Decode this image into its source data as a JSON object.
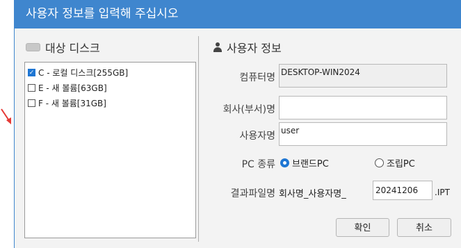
{
  "window": {
    "title": "사용자 정보를 입력해 주십시오"
  },
  "disks": {
    "title": "대상 디스크",
    "items": [
      {
        "label": "C - 로컬 디스크[255GB]",
        "checked": true
      },
      {
        "label": "E - 새 볼륨[63GB]",
        "checked": false
      },
      {
        "label": "F - 새 볼륨[31GB]",
        "checked": false
      }
    ]
  },
  "user": {
    "title": "사용자 정보",
    "computer_label": "컴퓨터명",
    "computer_value": "DESKTOP-WIN2024",
    "company_label": "회사(부서)명",
    "company_value": "",
    "username_label": "사용자명",
    "username_value": "user",
    "pc_type_label": "PC 종류",
    "pc_types": [
      {
        "label": "브랜드PC",
        "selected": true
      },
      {
        "label": "조립PC",
        "selected": false
      }
    ],
    "result_label": "결과파일명",
    "result_prefix": "회사명_사용자명_",
    "result_date": "20241206",
    "result_ext": ".IPT"
  },
  "buttons": {
    "ok": "확인",
    "cancel": "취소"
  },
  "colors": {
    "titlebar": "#3f86ce",
    "accent": "#1e76d3",
    "arrow": "#e53935"
  }
}
